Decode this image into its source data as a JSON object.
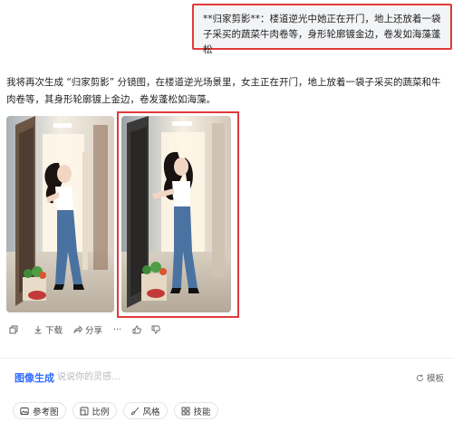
{
  "user_message": {
    "text": "**归家剪影**：楼道逆光中她正在开门，地上还放着一袋子采买的蔬菜牛肉卷等，身形轮廓镀金边，卷发如海藻蓬松"
  },
  "assistant_reply": {
    "text": "我将再次生成 “归家剪影” 分镜图，在楼道逆光场景里，女主正在开门，地上放着一袋子采买的蔬菜和牛肉卷等，其身形轮廓镀上金边，卷发蓬松如海藻。"
  },
  "images": [
    {
      "alt": "楼道逆光中开门的卷发女子-1",
      "icon": "generated-image"
    },
    {
      "alt": "楼道逆光中开门的卷发女子-2",
      "icon": "generated-image"
    }
  ],
  "actions": {
    "download_label": "下载",
    "share_label": "分享",
    "more_label": "···"
  },
  "composer": {
    "mode_label": "图像生成",
    "placeholder": "说说你的灵感...",
    "template_label": "模板",
    "chips": [
      {
        "label": "参考图",
        "icon": "image-icon"
      },
      {
        "label": "比例",
        "icon": "ratio-icon"
      },
      {
        "label": "风格",
        "icon": "brush-icon"
      },
      {
        "label": "技能",
        "icon": "grid-icon"
      }
    ]
  },
  "colors": {
    "accent": "#2f6bff",
    "highlight_border": "#e03a3a",
    "bubble_bg": "#f3f4f6"
  }
}
